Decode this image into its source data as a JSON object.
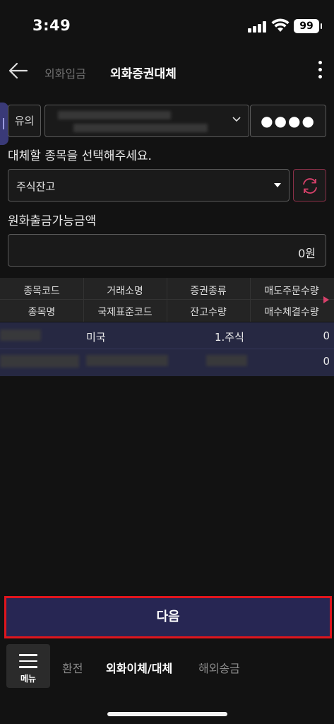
{
  "status_bar": {
    "time": "3:49",
    "battery": "99"
  },
  "header": {
    "tab_inactive": "외화입금",
    "tab_active": "외화증권대체"
  },
  "account": {
    "note_button": "유의",
    "password_mask": "●●●●"
  },
  "instruction": "대체할 종목을 선택해주세요.",
  "holding_select": {
    "value": "주식잔고"
  },
  "amount": {
    "label": "원화출금가능금액",
    "value": "0원"
  },
  "table": {
    "headers_row1": [
      "종목코드",
      "거래소명",
      "증권종류",
      "매도주문수량"
    ],
    "headers_row2": [
      "종목명",
      "국제표준코드",
      "잔고수량",
      "매수체결수량"
    ],
    "rows": [
      {
        "exchange": "미국",
        "security_type": "1.주식",
        "sell_order_qty": "0",
        "buy_filled_qty": "0"
      }
    ]
  },
  "next_button": "다음",
  "bottom_nav": {
    "menu_label": "메뉴",
    "items": [
      "환전",
      "외화이체/대체",
      "해외송금"
    ]
  },
  "colors": {
    "accent_primary": "#272653",
    "highlight_border": "#e0151d",
    "refresh_accent": "#d8416b",
    "selected_row": "#262842"
  }
}
